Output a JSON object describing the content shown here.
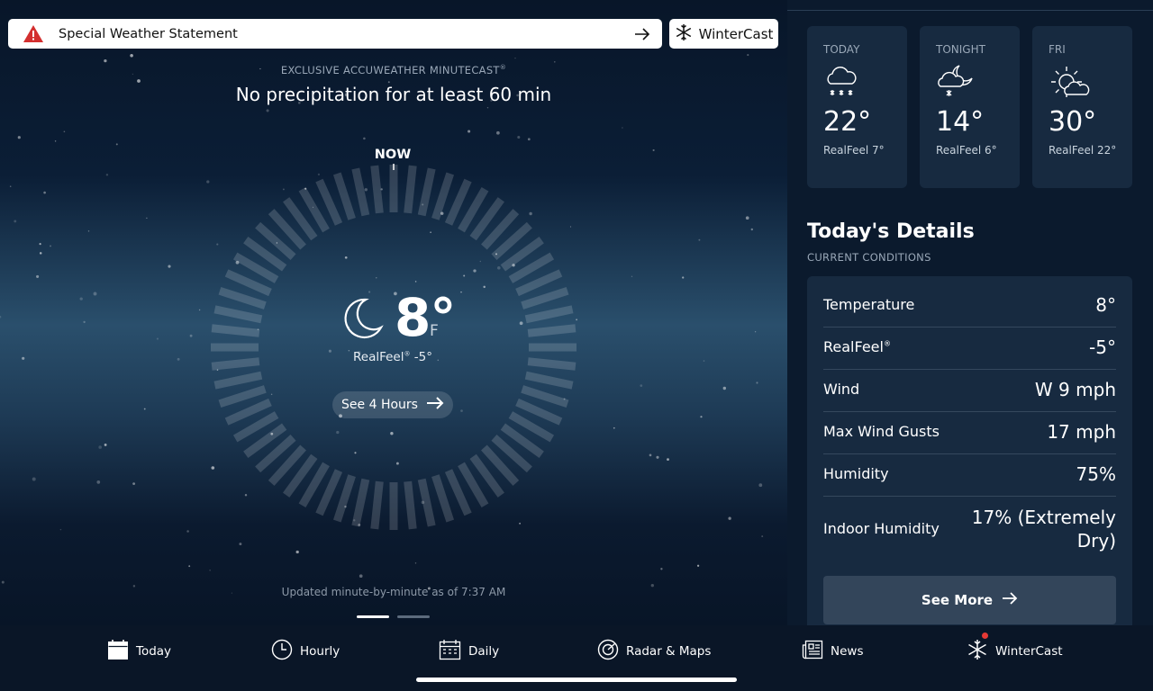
{
  "alert": {
    "label": "Special Weather Statement"
  },
  "wintercast_button": {
    "label": "WinterCast"
  },
  "minutecast": {
    "label": "EXCLUSIVE ACCUWEATHER MINUTECAST",
    "label_mark": "®",
    "headline": "No precipitation for at least 60 min",
    "now_label": "NOW",
    "updated": "Updated minute-by-minute as of 7:37 AM"
  },
  "current": {
    "temp": "8°",
    "unit": "F",
    "realfeel_label": "RealFeel",
    "realfeel_mark": "®",
    "realfeel_value": "-5°",
    "see_hours_label": "See 4 Hours",
    "icon": "moon-icon"
  },
  "forecast": [
    {
      "label": "TODAY",
      "temp": "22°",
      "realfeel": "RealFeel 7°",
      "icon": "snow-cloud-icon"
    },
    {
      "label": "TONIGHT",
      "temp": "14°",
      "realfeel": "RealFeel 6°",
      "icon": "moon-cloud-snow-icon"
    },
    {
      "label": "FRI",
      "temp": "30°",
      "realfeel": "RealFeel 22°",
      "icon": "sun-cloud-icon"
    }
  ],
  "details": {
    "title": "Today's Details",
    "subtitle": "CURRENT CONDITIONS",
    "rows": [
      {
        "key": "Temperature",
        "value": "8°"
      },
      {
        "key": "RealFeel",
        "key_mark": "®",
        "value": "-5°"
      },
      {
        "key": "Wind",
        "value": "W 9 mph"
      },
      {
        "key": "Max Wind Gusts",
        "value": "17 mph"
      },
      {
        "key": "Humidity",
        "value": "75%"
      },
      {
        "key": "Indoor Humidity",
        "value": "17% (Extremely Dry)"
      }
    ],
    "see_more_label": "See More"
  },
  "nav": [
    {
      "label": "Today",
      "icon": "calendar-today-icon"
    },
    {
      "label": "Hourly",
      "icon": "clock-icon"
    },
    {
      "label": "Daily",
      "icon": "calendar-icon"
    },
    {
      "label": "Radar & Maps",
      "icon": "radar-icon"
    },
    {
      "label": "News",
      "icon": "newspaper-icon"
    },
    {
      "label": "WinterCast",
      "icon": "snowflake-icon"
    }
  ],
  "colors": {
    "panel": "#172a40",
    "alert_red": "#d32f2f",
    "badge_red": "#e53935",
    "background": "#0b1a2d"
  }
}
